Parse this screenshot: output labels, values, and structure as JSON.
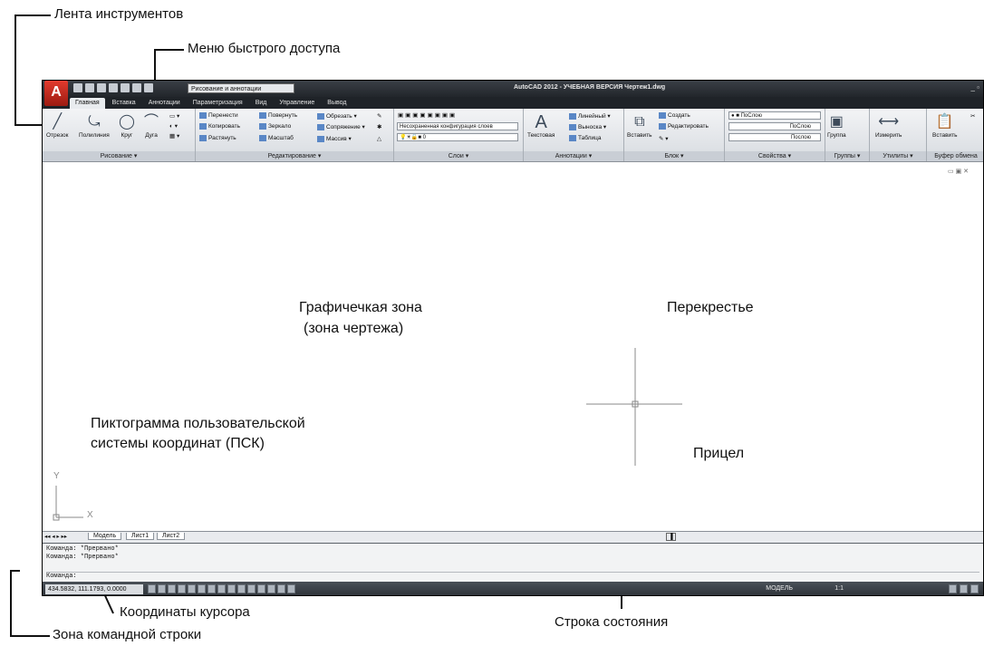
{
  "callouts": {
    "ribbon": "Лента инструментов",
    "qat": "Меню быстрого доступа",
    "graphic_zone_line1": "Графичечкая зона",
    "graphic_zone_line2": "(зона чертежа)",
    "crosshair": "Перекрестье",
    "pickbox": "Прицел",
    "ucs_line1": "Пиктограмма пользовательской",
    "ucs_line2": "системы координат (ПСК)",
    "cursor_coords": "Координаты курсора",
    "status_bar": "Строка состояния",
    "command_zone": "Зона командной строки"
  },
  "titlebar": {
    "title": "AutoCAD 2012 - УЧЕБНАЯ ВЕРСИЯ   Чертеж1.dwg",
    "workspace": "Рисование и аннотации"
  },
  "tabs": [
    {
      "label": "Главная"
    },
    {
      "label": "Вставка"
    },
    {
      "label": "Аннотации"
    },
    {
      "label": "Параметризация"
    },
    {
      "label": "Вид"
    },
    {
      "label": "Управление"
    },
    {
      "label": "Вывод"
    }
  ],
  "ribbon": {
    "draw": {
      "title": "Рисование ▾",
      "line": "Отрезок",
      "polyline": "Полилиния",
      "circle": "Круг",
      "arc": "Дуга"
    },
    "modify": {
      "title": "Редактирование ▾",
      "move": "Перенести",
      "rotate": "Повернуть",
      "trim": "Обрезать",
      "copy": "Копировать",
      "mirror": "Зеркало",
      "fillet": "Сопряжение",
      "stretch": "Растянуть",
      "scale": "Масштаб",
      "array": "Массив"
    },
    "layers": {
      "title": "Слои ▾",
      "state": "Несохраненная конфигурация слоев",
      "current": "0"
    },
    "annotation": {
      "title": "Аннотации ▾",
      "text": "Текстовая",
      "linear": "Линейный",
      "leader": "Выноска",
      "table": "Таблица"
    },
    "block": {
      "title": "Блок ▾",
      "insert": "Вставить",
      "create": "Создать",
      "edit": "Редактировать"
    },
    "properties": {
      "title": "Свойства ▾",
      "color": "ПоСлою",
      "linetype": "ПоСлою",
      "lineweight": "Послою"
    },
    "groups": {
      "title": "Группы ▾",
      "group": "Группа"
    },
    "utilities": {
      "title": "Утилиты ▾",
      "measure": "Измерить"
    },
    "clipboard": {
      "title": "Буфер обмена",
      "paste": "Вставить"
    }
  },
  "layout_tabs": [
    {
      "label": "Модель"
    },
    {
      "label": "Лист1"
    },
    {
      "label": "Лист2"
    }
  ],
  "command": {
    "line1": "Команда: *Прервано*",
    "line2": "Команда: *Прервано*",
    "prompt": "Команда:"
  },
  "status": {
    "coords": "434.5832, 111.1793, 0.0000",
    "model": "МОДЕЛЬ",
    "scale": "1:1"
  },
  "ucs": {
    "y": "Y",
    "x": "X"
  }
}
